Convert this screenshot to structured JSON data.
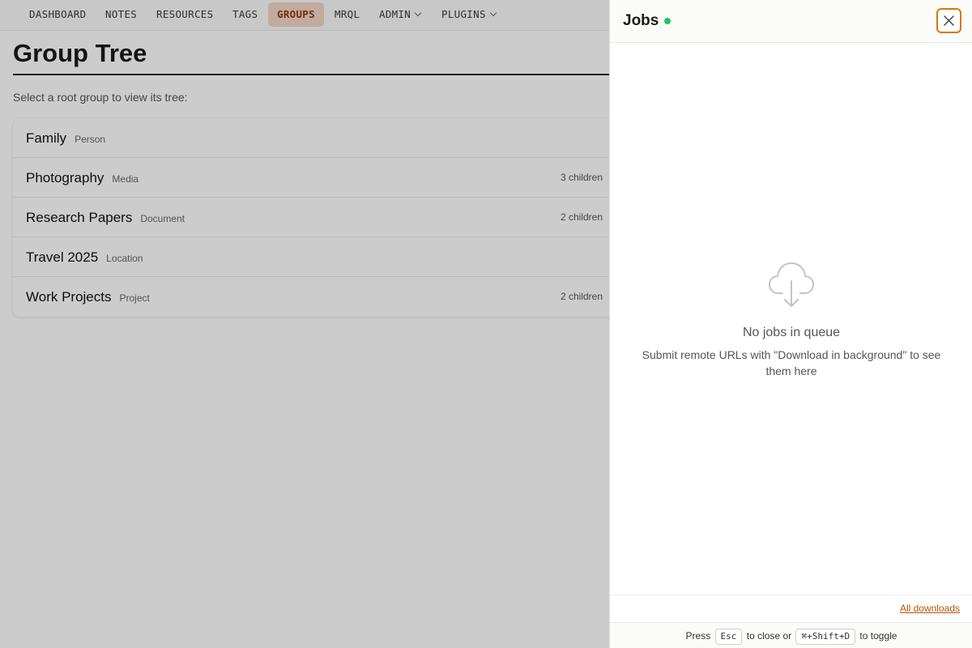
{
  "nav": {
    "items": [
      {
        "label": "DASHBOARD"
      },
      {
        "label": "NOTES"
      },
      {
        "label": "RESOURCES"
      },
      {
        "label": "TAGS"
      },
      {
        "label": "GROUPS"
      },
      {
        "label": "MRQL"
      },
      {
        "label": "ADMIN"
      },
      {
        "label": "PLUGINS"
      }
    ],
    "active": "GROUPS"
  },
  "page": {
    "title": "Group Tree",
    "subtitle": "Select a root group to view its tree:"
  },
  "groups": [
    {
      "name": "Family",
      "type": "Person",
      "children": ""
    },
    {
      "name": "Photography",
      "type": "Media",
      "children": "3 children"
    },
    {
      "name": "Research Papers",
      "type": "Document",
      "children": "2 children"
    },
    {
      "name": "Travel 2025",
      "type": "Location",
      "children": ""
    },
    {
      "name": "Work Projects",
      "type": "Project",
      "children": "2 children"
    }
  ],
  "drawer": {
    "title": "Jobs",
    "status_color": "#22c55e",
    "empty_icon": "cloud-download-icon",
    "empty_title": "No jobs in queue",
    "empty_desc": "Submit remote URLs with \"Download in background\" to see them here",
    "all_downloads_label": "All downloads",
    "shortcut": {
      "press": "Press",
      "close_key": "Esc",
      "close_text": "to close or",
      "toggle_key": "⌘+Shift+D",
      "toggle_text": "to toggle"
    }
  },
  "colors": {
    "accent": "#d97706",
    "active_nav_bg": "#f3d6c7",
    "link": "#b45309"
  }
}
